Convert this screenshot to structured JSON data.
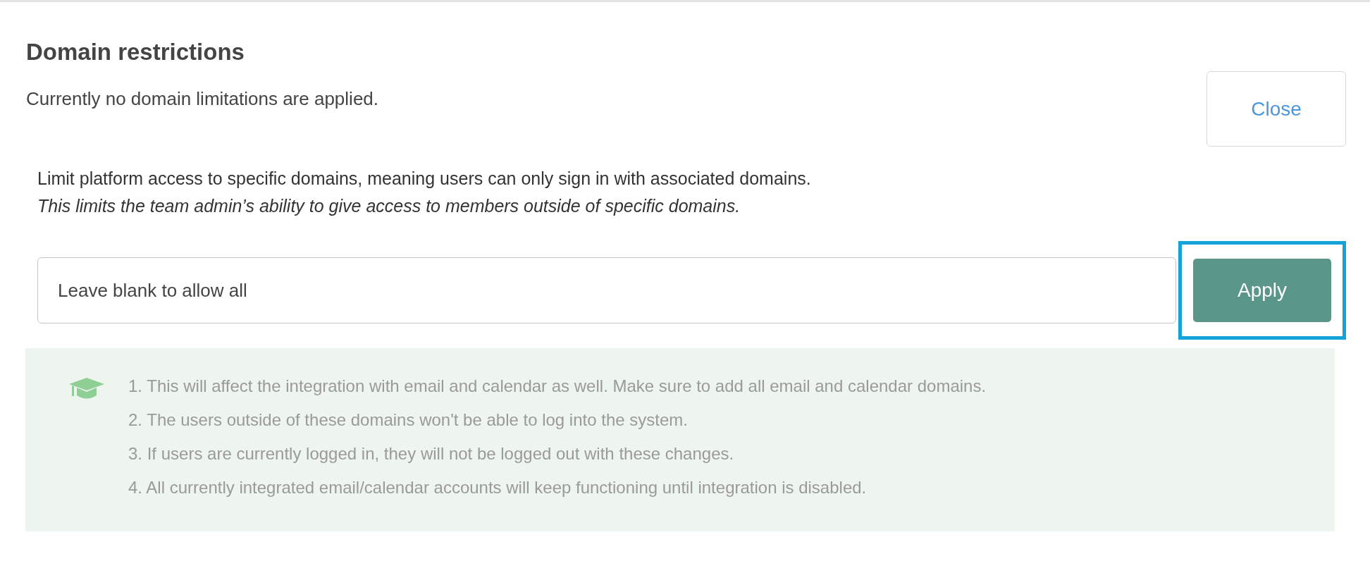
{
  "header": {
    "title": "Domain restrictions",
    "status": "Currently no domain limitations are applied.",
    "close_button": "Close"
  },
  "description": {
    "text": "Limit platform access to specific domains, meaning users can only sign in with associated domains.",
    "note": "This limits the team admin’s ability to give access to members outside of specific domains."
  },
  "domain_field": {
    "placeholder": "Leave blank to allow all"
  },
  "apply_button": {
    "label": "Apply",
    "focused": true
  },
  "info": {
    "items": [
      "1. This will affect the integration with email and calendar as well. Make sure to add all email and calendar domains.",
      "2. The users outside of these domains won't be able to log into the system.",
      "3. If users are currently logged in, they will not be logged out with these changes.",
      "4. All currently integrated email/calendar accounts will keep functioning until integration is disabled."
    ]
  }
}
